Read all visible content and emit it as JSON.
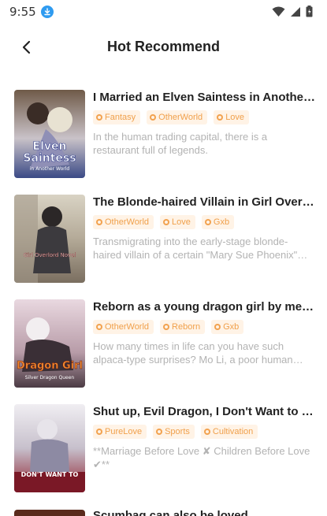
{
  "status": {
    "time": "9:55",
    "icons": [
      "download-icon",
      "wifi-icon",
      "signal-icon",
      "battery-icon"
    ]
  },
  "header": {
    "title": "Hot Recommend",
    "back_icon": "chevron-left-icon"
  },
  "colors": {
    "tag_bg": "#fff3e6",
    "tag_text": "#f0a04b",
    "desc_text": "#b3b3b3",
    "accent_blue": "#2f9bf0"
  },
  "books": [
    {
      "title": "I Married an Elven Saintess in Another World",
      "tags": [
        "Fantasy",
        "OtherWorld",
        "Love"
      ],
      "desc": "In the human trading capital, there is a restaurant full of legends.",
      "cover_text": [
        "Elven",
        "Saintess",
        "in Another World"
      ]
    },
    {
      "title": "The Blonde-haired Villain in Girl Overlord Novel",
      "tags": [
        "OtherWorld",
        "Love",
        "Gxb"
      ],
      "desc": "Transmigrating into the early-stage blonde-haired villain of a certain \"Mary Sue Phoenix\" novel",
      "cover_text": [
        "Girl Overlord Novel"
      ]
    },
    {
      "title": "Reborn as a young dragon girl by meeting alpaca",
      "tags": [
        "OtherWorld",
        "Reborn",
        "Gxb"
      ],
      "desc": "How many times in life can you have such alpaca-type surprises? Mo Li, a poor human turned dragon",
      "cover_text": [
        "Dragon Girl",
        "Silver Dragon Queen"
      ]
    },
    {
      "title": "Shut up, Evil Dragon, I Don't Want to Raise Children",
      "tags": [
        "PureLove",
        "Sports",
        "Cultivation"
      ],
      "desc": "**Marriage Before Love ✘  Children Before Love ✔**",
      "cover_text": [
        "DON'T WANT TO"
      ]
    }
  ],
  "partial_item": {
    "title": "Scumbag can also be loved"
  }
}
